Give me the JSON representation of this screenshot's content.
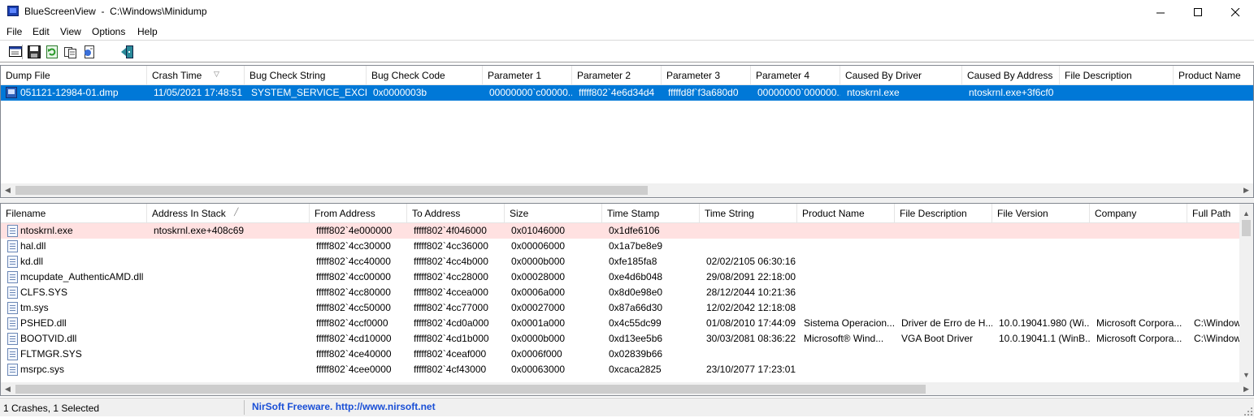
{
  "window": {
    "title": "BlueScreenView  -  C:\\Windows\\Minidump"
  },
  "menu": [
    "File",
    "Edit",
    "View",
    "Options",
    "Help"
  ],
  "toolbar": [
    "properties-icon",
    "save-icon",
    "refresh-icon",
    "copy-icon",
    "report-icon",
    "exit-icon"
  ],
  "top_pane": {
    "columns": [
      "Dump File",
      "Crash Time",
      "Bug Check String",
      "Bug Check Code",
      "Parameter 1",
      "Parameter 2",
      "Parameter 3",
      "Parameter 4",
      "Caused By Driver",
      "Caused By Address",
      "File Description",
      "Product Name"
    ],
    "rows": [
      [
        "051121-12984-01.dmp",
        "11/05/2021 17:48:51",
        "SYSTEM_SERVICE_EXCEP...",
        "0x0000003b",
        "00000000`c00000...",
        "fffff802`4e6d34d4",
        "fffffd8f`f3a680d0",
        "00000000`000000...",
        "ntoskrnl.exe",
        "ntoskrnl.exe+3f6cf0",
        "",
        ""
      ]
    ]
  },
  "bottom_pane": {
    "columns": [
      "Filename",
      "Address In Stack",
      "From Address",
      "To Address",
      "Size",
      "Time Stamp",
      "Time String",
      "Product Name",
      "File Description",
      "File Version",
      "Company",
      "Full Path"
    ],
    "rows": [
      [
        "ntoskrnl.exe",
        "ntoskrnl.exe+408c69",
        "fffff802`4e000000",
        "fffff802`4f046000",
        "0x01046000",
        "0x1dfe6106",
        "",
        "",
        "",
        "",
        "",
        ""
      ],
      [
        "hal.dll",
        "",
        "fffff802`4cc30000",
        "fffff802`4cc36000",
        "0x00006000",
        "0x1a7be8e9",
        "",
        "",
        "",
        "",
        "",
        ""
      ],
      [
        "kd.dll",
        "",
        "fffff802`4cc40000",
        "fffff802`4cc4b000",
        "0x0000b000",
        "0xfe185fa8",
        "02/02/2105 06:30:16",
        "",
        "",
        "",
        "",
        ""
      ],
      [
        "mcupdate_AuthenticAMD.dll",
        "",
        "fffff802`4cc00000",
        "fffff802`4cc28000",
        "0x00028000",
        "0xe4d6b048",
        "29/08/2091 22:18:00",
        "",
        "",
        "",
        "",
        ""
      ],
      [
        "CLFS.SYS",
        "",
        "fffff802`4cc80000",
        "fffff802`4ccea000",
        "0x0006a000",
        "0x8d0e98e0",
        "28/12/2044 10:21:36",
        "",
        "",
        "",
        "",
        ""
      ],
      [
        "tm.sys",
        "",
        "fffff802`4cc50000",
        "fffff802`4cc77000",
        "0x00027000",
        "0x87a66d30",
        "12/02/2042 12:18:08",
        "",
        "",
        "",
        "",
        ""
      ],
      [
        "PSHED.dll",
        "",
        "fffff802`4ccf0000",
        "fffff802`4cd0a000",
        "0x0001a000",
        "0x4c55dc99",
        "01/08/2010 17:44:09",
        "Sistema Operacion...",
        "Driver de Erro de H...",
        "10.0.19041.980 (Wi...",
        "Microsoft Corpora...",
        "C:\\Window"
      ],
      [
        "BOOTVID.dll",
        "",
        "fffff802`4cd10000",
        "fffff802`4cd1b000",
        "0x0000b000",
        "0xd13ee5b6",
        "30/03/2081 08:36:22",
        "Microsoft® Wind...",
        "VGA Boot Driver",
        "10.0.19041.1 (WinB...",
        "Microsoft Corpora...",
        "C:\\Window"
      ],
      [
        "FLTMGR.SYS",
        "",
        "fffff802`4ce40000",
        "fffff802`4ceaf000",
        "0x0006f000",
        "0x02839b66",
        "",
        "",
        "",
        "",
        "",
        ""
      ],
      [
        "msrpc.sys",
        "",
        "fffff802`4cee0000",
        "fffff802`4cf43000",
        "0x00063000",
        "0xcaca2825",
        "23/10/2077 17:23:01",
        "",
        "",
        "",
        "",
        ""
      ]
    ]
  },
  "status": {
    "crashes": "1 Crashes, 1 Selected",
    "credit": "NirSoft Freeware.  http://www.nirsoft.net"
  },
  "colors": {
    "selection": "#0078d7",
    "highlight": "#ffe1e1",
    "link": "#1a4fd6"
  }
}
